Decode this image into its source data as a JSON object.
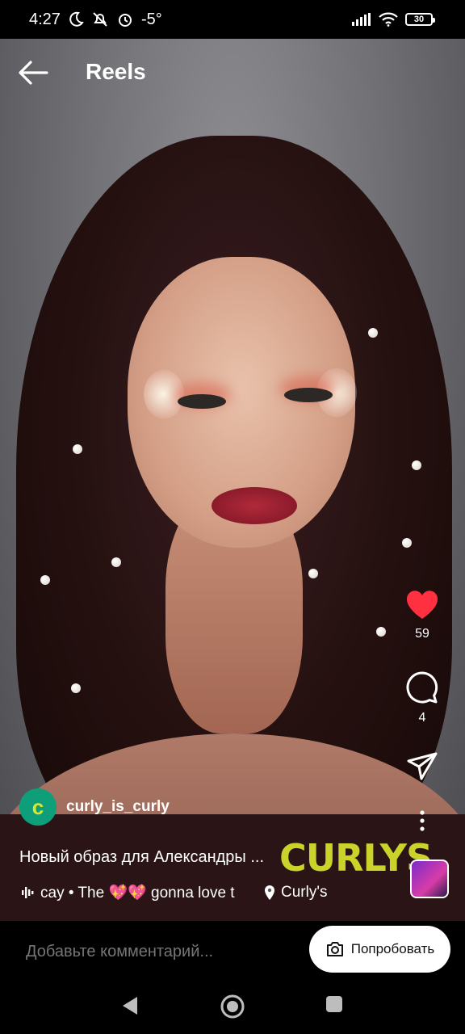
{
  "status_bar": {
    "time": "4:27",
    "temperature": "-5°",
    "battery": "30",
    "icons": [
      "moon-icon",
      "mute-icon",
      "alarm-icon",
      "signal-icon",
      "wifi-icon",
      "battery-icon"
    ]
  },
  "header": {
    "title": "Reels",
    "back_icon": "arrow-left-icon"
  },
  "actions": {
    "like_count": "59",
    "comment_count": "4",
    "icons": [
      "heart-icon",
      "comment-icon",
      "share-icon",
      "more-icon"
    ]
  },
  "post": {
    "username": "curly_is_curly",
    "avatar_letter": "c",
    "caption": "Новый образ для Александры ...",
    "brand_logo": "CURLYS",
    "music": "cay • The 💖💖 gonna love t",
    "location": "Curly's"
  },
  "comment_bar": {
    "placeholder": "Добавьте комментарий...",
    "try_button_label": "Попробовать"
  },
  "colors": {
    "like": "#ff3040",
    "brand": "#c9d32a",
    "avatar_bg": "#0e9e7a"
  }
}
